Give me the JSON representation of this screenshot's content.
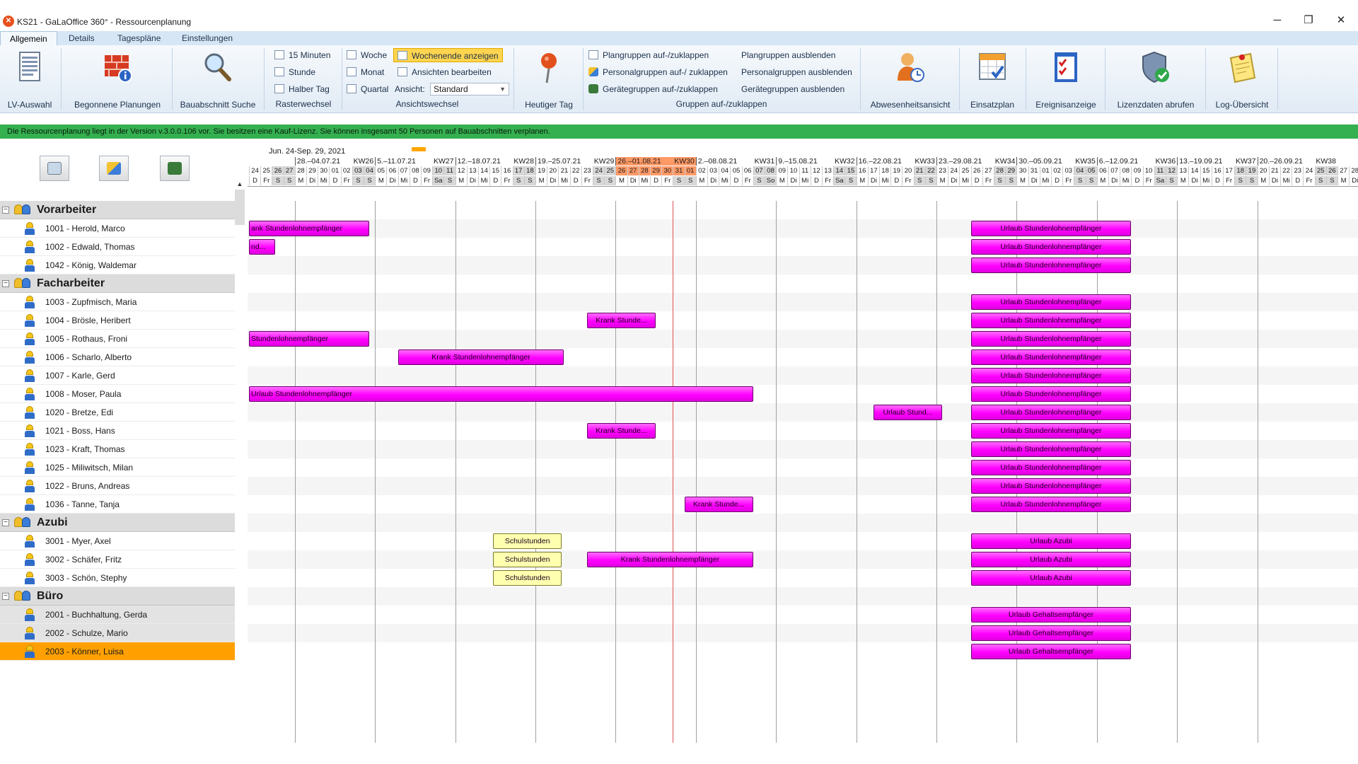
{
  "window": {
    "title": "KS21 - GaLaOffice 360° - Ressourcenplanung",
    "minimize": "─",
    "restore": "❐",
    "close": "✕",
    "logo_glyph": "✕"
  },
  "menu": [
    "Allgemein",
    "Details",
    "Tagespläne",
    "Einstellungen"
  ],
  "ribbon": {
    "big": [
      "LV-Auswahl",
      "Begonnene Planungen",
      "Bauabschnitt Suche",
      "Heutiger Tag",
      "Abwesenheitsansicht",
      "Einsatzplan",
      "Ereignisanzeige",
      "Lizenzdaten abrufen",
      "Log-Übersicht"
    ],
    "raster": [
      "15 Minuten",
      "Stunde",
      "Halber Tag"
    ],
    "raster_group": "Rasterwechsel",
    "ansicht": [
      "Woche",
      "Monat",
      "Quartal"
    ],
    "ansicht2": [
      "Wochenende anzeigen",
      "Ansichten bearbeiten"
    ],
    "ansicht_label": "Ansicht:",
    "ansicht_value": "Standard",
    "ansicht_group": "Ansichtswechsel",
    "gruppen_a": [
      "Plangruppen auf-/zuklappen",
      "Personalgruppen auf-/ zuklappen",
      "Gerätegruppen auf-/zuklappen"
    ],
    "gruppen_b": [
      "Plangruppen ausblenden",
      "Personalgruppen ausblenden",
      "Gerätegruppen ausblenden"
    ],
    "gruppen_group": "Gruppen auf-/zuklappen"
  },
  "status": "Die Ressourcenplanung liegt in der Version v.3.0.0.106 vor. Sie besitzen eine Kauf-Lizenz. Sie können insgesamt 50 Personen auf Bauabschnitten verplanen.",
  "range": "Jun. 24-Sep. 29, 2021",
  "weeks": [
    {
      "l": "28.–04.07.21",
      "k": "KW26"
    },
    {
      "l": "5.–11.07.21",
      "k": "KW27"
    },
    {
      "l": "12.–18.07.21",
      "k": "KW28"
    },
    {
      "l": "19.–25.07.21",
      "k": "KW29"
    },
    {
      "l": "26.–01.08.21",
      "k": "KW30"
    },
    {
      "l": "2.–08.08.21",
      "k": "KW31"
    },
    {
      "l": "9.–15.08.21",
      "k": "KW32"
    },
    {
      "l": "16.–22.08.21",
      "k": "KW33"
    },
    {
      "l": "23.–29.08.21",
      "k": "KW34"
    },
    {
      "l": "30.–05.09.21",
      "k": "KW35"
    },
    {
      "l": "6.–12.09.21",
      "k": "KW36"
    },
    {
      "l": "13.–19.09.21",
      "k": "KW37"
    },
    {
      "l": "20.–26.09.21",
      "k": "KW38"
    }
  ],
  "current_week": "KW30",
  "days_start": 24,
  "days": [
    "24",
    "25",
    "26",
    "27",
    "28",
    "29",
    "30",
    "01",
    "02",
    "03",
    "04",
    "05",
    "06",
    "07",
    "08",
    "09",
    "10",
    "11",
    "12",
    "13",
    "14",
    "15",
    "16",
    "17",
    "18",
    "19",
    "20",
    "21",
    "22",
    "23",
    "24",
    "25",
    "26",
    "27",
    "28",
    "29",
    "30",
    "31",
    "01",
    "02",
    "03",
    "04",
    "05",
    "06",
    "07",
    "08",
    "09",
    "10",
    "11",
    "12",
    "13",
    "14",
    "15",
    "16",
    "17",
    "18",
    "19",
    "20",
    "21",
    "22",
    "23",
    "24",
    "25",
    "26",
    "27",
    "28",
    "29",
    "30",
    "31",
    "01",
    "02",
    "03",
    "04",
    "05",
    "06",
    "07",
    "08",
    "09",
    "10",
    "11",
    "12",
    "13",
    "14",
    "15",
    "16",
    "17",
    "18",
    "19",
    "20",
    "21",
    "22",
    "23",
    "24",
    "25",
    "26",
    "27",
    "28"
  ],
  "daynames": [
    "D",
    "Fr",
    "S",
    "S",
    "M",
    "Di",
    "Mi",
    "D",
    "Fr",
    "S",
    "S",
    "M",
    "Di",
    "Mi",
    "D",
    "Fr",
    "Sa",
    "S",
    "M",
    "Di",
    "Mi",
    "D",
    "Fr",
    "S",
    "S",
    "M",
    "Di",
    "Mi",
    "D",
    "Fr",
    "S",
    "S",
    "M",
    "Di",
    "Mi",
    "D",
    "Fr",
    "S",
    "S",
    "M",
    "Di",
    "Mi",
    "D",
    "Fr",
    "S",
    "So",
    "M",
    "Di",
    "Mi",
    "D",
    "Fr",
    "Sa",
    "S",
    "M",
    "Di",
    "Mi",
    "D",
    "Fr",
    "S",
    "S",
    "M",
    "Di",
    "Mi",
    "D",
    "Fr",
    "S",
    "S",
    "M",
    "Di",
    "Mi",
    "D",
    "Fr",
    "S",
    "S",
    "M",
    "Di",
    "Mi",
    "D",
    "Fr",
    "Sa",
    "S",
    "M",
    "Di",
    "Mi",
    "D",
    "Fr",
    "S",
    "S",
    "M",
    "Di",
    "Mi",
    "D",
    "Fr",
    "S",
    "S",
    "M",
    "Di"
  ],
  "tree": [
    {
      "type": "group",
      "label": "Vorarbeiter",
      "toggle": "−"
    },
    {
      "type": "person",
      "label": "1001 - Herold, Marco"
    },
    {
      "type": "person",
      "label": "1002 - Edwald, Thomas"
    },
    {
      "type": "person",
      "label": "1042 - König, Waldemar"
    },
    {
      "type": "group",
      "label": "Facharbeiter",
      "toggle": "−"
    },
    {
      "type": "person",
      "label": "1003 - Zupfmisch, Maria"
    },
    {
      "type": "person",
      "label": "1004 - Brösle, Heribert"
    },
    {
      "type": "person",
      "label": "1005 - Rothaus, Froni"
    },
    {
      "type": "person",
      "label": "1006 - Scharlo, Alberto"
    },
    {
      "type": "person",
      "label": "1007 - Karle, Gerd"
    },
    {
      "type": "person",
      "label": "1008 - Moser, Paula"
    },
    {
      "type": "person",
      "label": "1020 - Bretze, Edi"
    },
    {
      "type": "person",
      "label": "1021 - Boss, Hans"
    },
    {
      "type": "person",
      "label": "1023 - Kraft, Thomas"
    },
    {
      "type": "person",
      "label": "1025 - Miliwitsch, Milan"
    },
    {
      "type": "person",
      "label": "1022 - Bruns, Andreas"
    },
    {
      "type": "person",
      "label": "1036 - Tanne, Tanja"
    },
    {
      "type": "group",
      "label": "Azubi",
      "toggle": "−"
    },
    {
      "type": "person",
      "label": "3001 - Myer, Axel"
    },
    {
      "type": "person",
      "label": "3002 - Schäfer, Fritz"
    },
    {
      "type": "person",
      "label": "3003 - Schön, Stephy"
    },
    {
      "type": "group",
      "label": "Büro",
      "toggle": "−"
    },
    {
      "type": "person",
      "label": "2001 - Buchhaltung, Gerda",
      "grey": true
    },
    {
      "type": "person",
      "label": "2002 - Schulze, Mario",
      "grey": true
    },
    {
      "type": "person",
      "label": "2003 - Könner, Luisa",
      "selected": true
    }
  ],
  "bars": [
    {
      "row": 1,
      "s": 0,
      "e": 10.5,
      "t": "ank Stundenlohnempfänger",
      "c": "mag"
    },
    {
      "row": 1,
      "s": 63,
      "e": 77,
      "t": "Urlaub Stundenlohnempfänger",
      "c": "mag"
    },
    {
      "row": 2,
      "s": 0,
      "e": 2.3,
      "t": "nd...",
      "c": "mag"
    },
    {
      "row": 2,
      "s": 63,
      "e": 77,
      "t": "Urlaub Stundenlohnempfänger",
      "c": "mag"
    },
    {
      "row": 3,
      "s": 63,
      "e": 77,
      "t": "Urlaub Stundenlohnempfänger",
      "c": "mag"
    },
    {
      "row": 5,
      "s": 63,
      "e": 77,
      "t": "Urlaub Stundenlohnempfänger",
      "c": "mag"
    },
    {
      "row": 6,
      "s": 29.5,
      "e": 35.5,
      "t": "Krank Stunde...",
      "c": "mag"
    },
    {
      "row": 6,
      "s": 63,
      "e": 77,
      "t": "Urlaub Stundenlohnempfänger",
      "c": "mag"
    },
    {
      "row": 7,
      "s": 0,
      "e": 10.5,
      "t": "Stundenlohnempfänger",
      "c": "mag"
    },
    {
      "row": 7,
      "s": 63,
      "e": 77,
      "t": "Urlaub Stundenlohnempfänger",
      "c": "mag"
    },
    {
      "row": 8,
      "s": 13,
      "e": 27.5,
      "t": "Krank Stundenlohnempfänger",
      "c": "mag"
    },
    {
      "row": 8,
      "s": 63,
      "e": 77,
      "t": "Urlaub Stundenlohnempfänger",
      "c": "mag"
    },
    {
      "row": 9,
      "s": 63,
      "e": 77,
      "t": "Urlaub Stundenlohnempfänger",
      "c": "mag"
    },
    {
      "row": 10,
      "s": 0,
      "e": 44,
      "t": "Urlaub Stundenlohnempfänger",
      "c": "mag"
    },
    {
      "row": 10,
      "s": 63,
      "e": 77,
      "t": "Urlaub Stundenlohnempfänger",
      "c": "mag"
    },
    {
      "row": 11,
      "s": 54.5,
      "e": 60.5,
      "t": "Urlaub Stund...",
      "c": "mag"
    },
    {
      "row": 11,
      "s": 63,
      "e": 77,
      "t": "Urlaub Stundenlohnempfänger",
      "c": "mag"
    },
    {
      "row": 12,
      "s": 29.5,
      "e": 35.5,
      "t": "Krank Stunde...",
      "c": "mag"
    },
    {
      "row": 12,
      "s": 63,
      "e": 77,
      "t": "Urlaub Stundenlohnempfänger",
      "c": "mag"
    },
    {
      "row": 13,
      "s": 63,
      "e": 77,
      "t": "Urlaub Stundenlohnempfänger",
      "c": "mag"
    },
    {
      "row": 14,
      "s": 63,
      "e": 77,
      "t": "Urlaub Stundenlohnempfänger",
      "c": "mag"
    },
    {
      "row": 15,
      "s": 63,
      "e": 77,
      "t": "Urlaub Stundenlohnempfänger",
      "c": "mag"
    },
    {
      "row": 16,
      "s": 38,
      "e": 44,
      "t": "Krank Stunde...",
      "c": "mag"
    },
    {
      "row": 16,
      "s": 63,
      "e": 77,
      "t": "Urlaub Stundenlohnempfänger",
      "c": "mag"
    },
    {
      "row": 18,
      "s": 21.3,
      "e": 27.3,
      "t": "Schulstunden",
      "c": "yel"
    },
    {
      "row": 18,
      "s": 63,
      "e": 77,
      "t": "Urlaub Azubi",
      "c": "mag"
    },
    {
      "row": 18,
      "s": 104.5,
      "e": 110.5,
      "t": "Schulstunden",
      "c": "yel"
    },
    {
      "row": 19,
      "s": 21.3,
      "e": 27.3,
      "t": "Schulstunden",
      "c": "yel"
    },
    {
      "row": 19,
      "s": 29.5,
      "e": 44,
      "t": "Krank Stundenlohnempfänger",
      "c": "mag"
    },
    {
      "row": 19,
      "s": 63,
      "e": 77,
      "t": "Urlaub Azubi",
      "c": "mag"
    },
    {
      "row": 19,
      "s": 104.5,
      "e": 110.5,
      "t": "Schulstunden",
      "c": "yel"
    },
    {
      "row": 20,
      "s": 21.3,
      "e": 27.3,
      "t": "Schulstunden",
      "c": "yel"
    },
    {
      "row": 20,
      "s": 63,
      "e": 77,
      "t": "Urlaub Azubi",
      "c": "mag"
    },
    {
      "row": 20,
      "s": 104.5,
      "e": 110.5,
      "t": "Schulstunden",
      "c": "yel"
    },
    {
      "row": 22,
      "s": 63,
      "e": 77,
      "t": "Urlaub Gehaltsempfänger",
      "c": "mag"
    },
    {
      "row": 23,
      "s": 63,
      "e": 77,
      "t": "Urlaub Gehaltsempfänger",
      "c": "mag"
    },
    {
      "row": 24,
      "s": 63,
      "e": 77,
      "t": "Urlaub Gehaltsempfänger",
      "c": "mag"
    }
  ],
  "colors": {
    "accent": "#ff00ff",
    "status": "#34b050",
    "selected": "#ffa000",
    "current_week": "#ff9966"
  }
}
